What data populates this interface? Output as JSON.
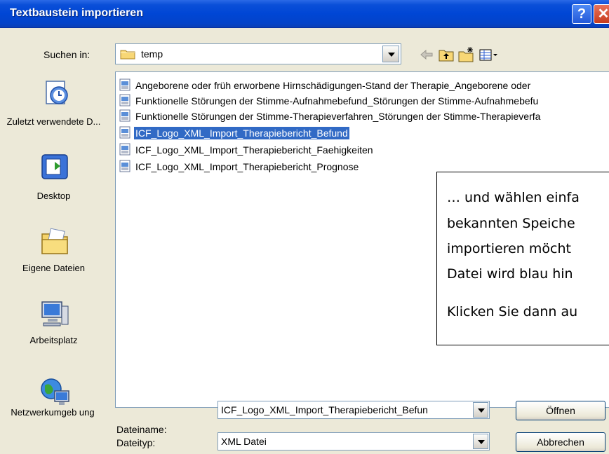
{
  "window": {
    "title": "Textbaustein importieren",
    "help_glyph": "?",
    "close_glyph": "✕"
  },
  "lookin": {
    "label": "Suchen in:",
    "value": "temp"
  },
  "toolbar": {
    "icons": [
      "back-icon",
      "up-folder-icon",
      "new-folder-icon",
      "view-menu-icon"
    ]
  },
  "places": [
    {
      "label": "Zuletzt verwendete D...",
      "icon": "recent-documents-icon"
    },
    {
      "label": "Desktop",
      "icon": "desktop-icon"
    },
    {
      "label": "Eigene Dateien",
      "icon": "my-documents-icon"
    },
    {
      "label": "Arbeitsplatz",
      "icon": "my-computer-icon"
    },
    {
      "label": "Netzwerkumgeb ung",
      "icon": "network-icon"
    }
  ],
  "files": [
    "Angeborene oder früh erworbene Hirnschädigungen-Stand der Therapie_Angeborene oder",
    "Funktionelle Störungen der Stimme-Aufnahmebefund_Störungen der Stimme-Aufnahmebefu",
    "Funktionelle Störungen der Stimme-Therapieverfahren_Störungen der Stimme-Therapieverfa",
    "ICF_Logo_XML_Import_Therapiebericht_Befund",
    "ICF_Logo_XML_Import_Therapiebericht_Faehigkeiten",
    "ICF_Logo_XML_Import_Therapiebericht_Prognose"
  ],
  "selected_file": "ICF_Logo_XML_Import_Therapiebericht_Befund",
  "callout": {
    "lines": [
      "… und wählen einfa",
      "bekannten Speiche",
      "importieren möcht",
      "Datei wird blau hin"
    ],
    "line2": "Klicken Sie dann au"
  },
  "filename": {
    "label": "Dateiname:",
    "value": "ICF_Logo_XML_Import_Therapiebericht_Befun"
  },
  "filetype": {
    "label": "Dateityp:",
    "value": "XML Datei"
  },
  "buttons": {
    "open": "Öffnen",
    "cancel": "Abbrechen"
  },
  "colors": {
    "titlebar": "#0046d5",
    "selection": "#316ac5",
    "dialog_bg": "#ece9d8"
  }
}
